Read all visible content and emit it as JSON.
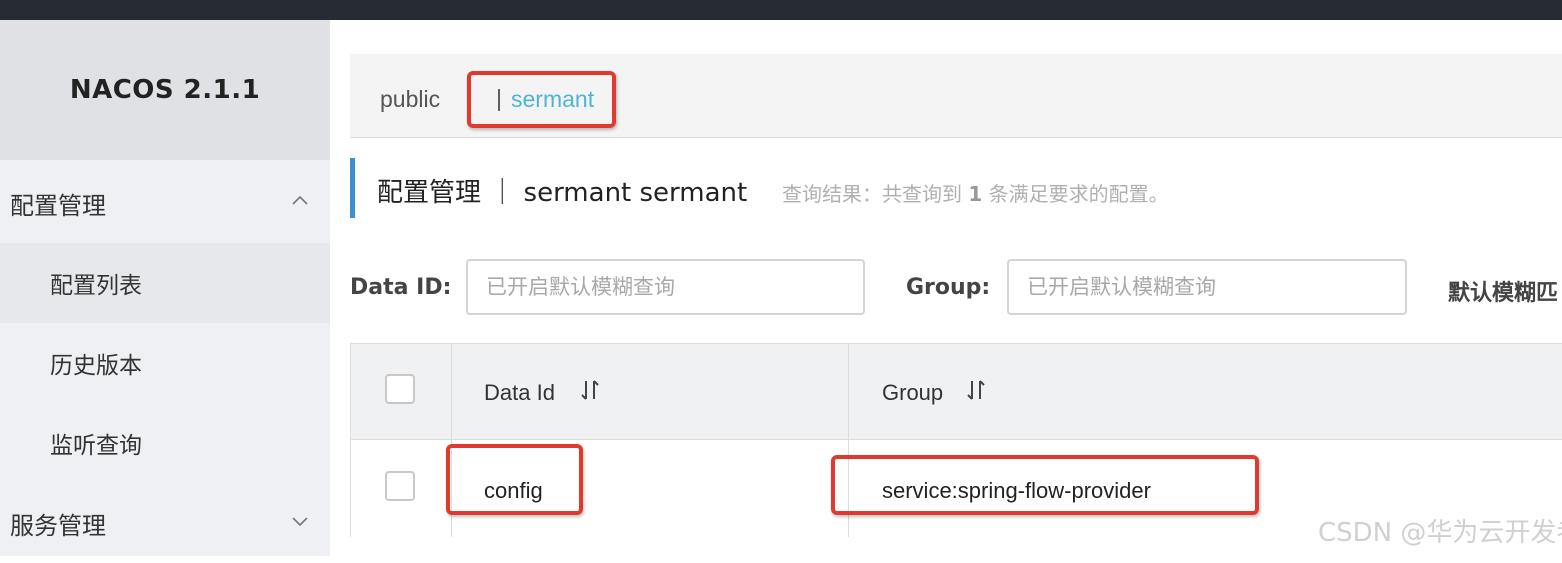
{
  "app": {
    "logo": "NACOS 2.1.1"
  },
  "sidebar": {
    "groups": [
      {
        "label": "配置管理",
        "expanded": true,
        "items": [
          {
            "label": "配置列表"
          },
          {
            "label": "历史版本"
          },
          {
            "label": "监听查询"
          }
        ]
      },
      {
        "label": "服务管理",
        "expanded": false
      }
    ]
  },
  "namespaces": {
    "items": [
      {
        "label": "public"
      },
      {
        "label": "sermant"
      }
    ],
    "separator": "|",
    "active": "sermant"
  },
  "page": {
    "title": "配置管理 ｜ sermant  sermant",
    "result_prefix": "查询结果：共查询到 ",
    "result_count": "1",
    "result_suffix": " 条满足要求的配置。"
  },
  "filters": {
    "data_id_label": "Data ID:",
    "data_id_placeholder": "已开启默认模糊查询",
    "group_label": "Group:",
    "group_placeholder": "已开启默认模糊查询",
    "default_fuzzy_label": "默认模糊匹"
  },
  "table": {
    "columns": [
      {
        "label": "Data Id"
      },
      {
        "label": "Group"
      }
    ],
    "rows": [
      {
        "data_id": "config",
        "group": "service:spring-flow-provider"
      }
    ]
  },
  "watermark": {
    "text": "CSDN @华为云开发者社区"
  },
  "colors": {
    "topbar": "#252a33",
    "sidebar_bg": "#eef0f3",
    "accent_blue": "#3c8fd0",
    "namespace_active": "#4fb3d8",
    "annotation_red": "#e03a2e"
  }
}
